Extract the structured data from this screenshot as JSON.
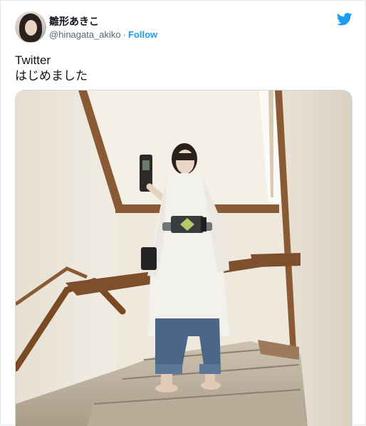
{
  "user": {
    "display_name": "雛形あきこ",
    "handle": "@hinagata_akiko",
    "separator": "·",
    "follow_label": "Follow"
  },
  "tweet": {
    "lines": [
      "Twitter",
      "はじめました"
    ]
  },
  "icons": {
    "platform": "twitter-bird-icon",
    "avatar": "profile-photo"
  },
  "colors": {
    "accent": "#1d9bf0",
    "text": "#0f1419",
    "secondary": "#536471"
  }
}
